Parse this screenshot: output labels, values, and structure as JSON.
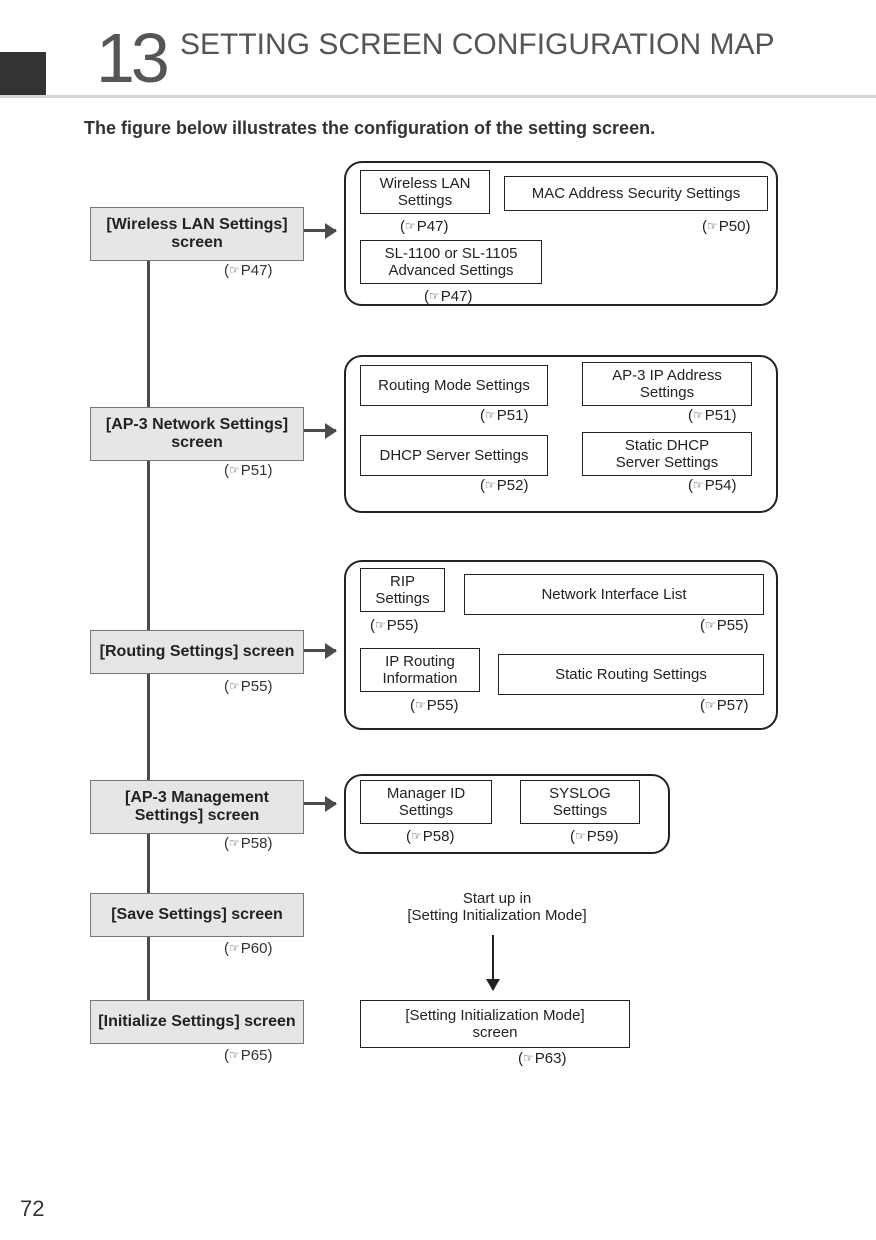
{
  "page_number": "72",
  "chapter_number": "13",
  "chapter_title": "SETTING SCREEN CONFIGURATION MAP",
  "subtitle": "The figure below illustrates the configuration of the setting screen.",
  "screens": {
    "wlan": {
      "label": "[Wireless LAN Settings]\nscreen",
      "ref": "P47"
    },
    "network": {
      "label": "[AP-3 Network Settings]\nscreen",
      "ref": "P51"
    },
    "routing": {
      "label": "[Routing Settings] screen",
      "ref": "P55"
    },
    "mgmt": {
      "label": "[AP-3 Management\nSettings] screen",
      "ref": "P58"
    },
    "save": {
      "label": "[Save Settings] screen",
      "ref": "P60"
    },
    "init": {
      "label": "[Initialize Settings] screen",
      "ref": "P65"
    }
  },
  "panels": {
    "wlan": {
      "items": [
        {
          "label": "Wireless LAN\nSettings",
          "ref": "P47"
        },
        {
          "label": "MAC Address Security Settings",
          "ref": "P50"
        },
        {
          "label": "SL-1100 or SL-1105\nAdvanced Settings",
          "ref": "P47"
        }
      ]
    },
    "network": {
      "items": [
        {
          "label": "Routing Mode Settings",
          "ref": "P51"
        },
        {
          "label": "AP-3 IP Address\nSettings",
          "ref": "P51"
        },
        {
          "label": "DHCP Server Settings",
          "ref": "P52"
        },
        {
          "label": "Static DHCP\nServer Settings",
          "ref": "P54"
        }
      ]
    },
    "routing": {
      "items": [
        {
          "label": "RIP\nSettings",
          "ref": "P55"
        },
        {
          "label": "Network Interface List",
          "ref": "P55"
        },
        {
          "label": "IP Routing\nInformation",
          "ref": "P55"
        },
        {
          "label": "Static Routing Settings",
          "ref": "P57"
        }
      ]
    },
    "mgmt": {
      "items": [
        {
          "label": "Manager ID\nSettings",
          "ref": "P58"
        },
        {
          "label": "SYSLOG\nSettings",
          "ref": "P59"
        }
      ]
    }
  },
  "startup_text": "Start up in\n[Setting Initialization Mode]",
  "init_mode_box": {
    "label": "[Setting Initialization Mode]\nscreen",
    "ref": "P63"
  }
}
